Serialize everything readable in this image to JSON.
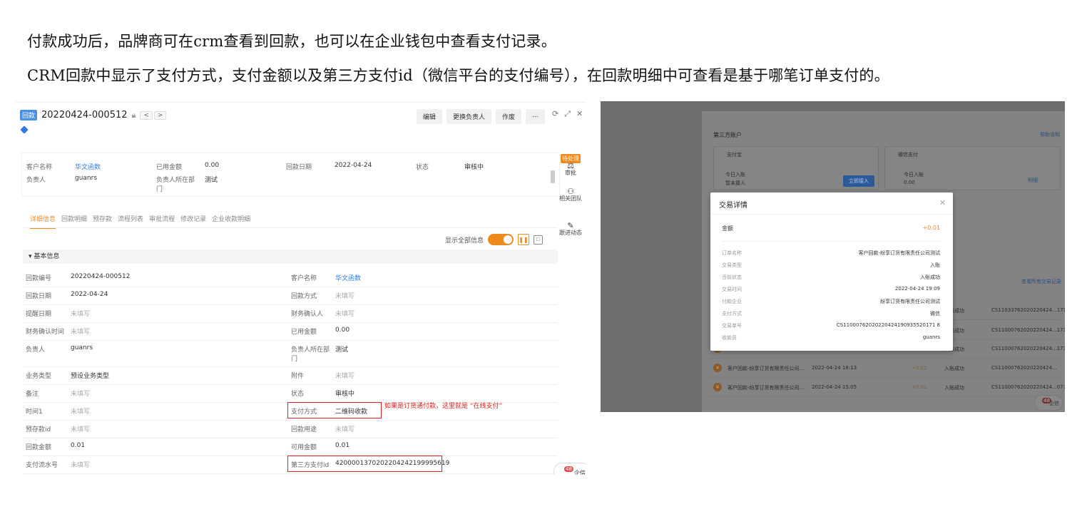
{
  "intro": {
    "line1": "付款成功后，品牌商可在crm查看到回款，也可以在企业钱包中查看支付记录。",
    "line2": "CRM回款中显示了支付方式，支付金额以及第三方支付id（微信平台的支付编号），在回款明细中可查看是基于哪笔订单支付的。"
  },
  "left": {
    "tag": "回款",
    "number": "20220424-000512",
    "actions": [
      "编辑",
      "更换负责人",
      "作废",
      "..."
    ],
    "summary": {
      "customer_label": "客户名称",
      "customer": "华文函数",
      "used_label": "已用金额",
      "used": "0.00",
      "date_label": "回款日期",
      "date": "2022-04-24",
      "status_label": "状态",
      "status": "审核中",
      "owner_label": "负责人",
      "owner": "guanrs",
      "dept_label": "负责人所在部门",
      "dept": "测试"
    },
    "tabs": [
      "详细信息",
      "回款明细",
      "预存款",
      "流程列表",
      "审批流程",
      "修改记录",
      "企业收款明细"
    ],
    "show_all": "显示全部信息",
    "section": "基本信息",
    "rows": [
      {
        "l1": "回款编号",
        "v1": "20220424-000512",
        "l2": "客户名称",
        "v2": "华文函数"
      },
      {
        "l1": "回款日期",
        "v1": "2022-04-24",
        "l2": "回款方式",
        "v2": "未填写"
      },
      {
        "l1": "提醒日期",
        "v1": "未填写",
        "l2": "财务确认人",
        "v2": "未填写"
      },
      {
        "l1": "财务确认时间",
        "v1": "未填写",
        "l2": "已用金额",
        "v2": "0.00"
      },
      {
        "l1": "负责人",
        "v1": "guanrs",
        "l2": "负责人所在部门",
        "v2": "测试"
      },
      {
        "l1": "业务类型",
        "v1": "预设业务类型",
        "l2": "附件",
        "v2": "未填写"
      },
      {
        "l1": "备注",
        "v1": "未填写",
        "l2": "状态",
        "v2": "审核中"
      },
      {
        "l1": "时间1",
        "v1": "未填写",
        "l2": "支付方式",
        "v2": "二维码收款"
      },
      {
        "l1": "预存款id",
        "v1": "未填写",
        "l2": "回款用途",
        "v2": "未填写"
      },
      {
        "l1": "回款金额",
        "v1": "0.01",
        "l2": "可用金额",
        "v2": "0.01"
      },
      {
        "l1": "支付流水号",
        "v1": "未填写",
        "l2": "第三方支付id",
        "v2": "4200001370202204242199995619"
      }
    ],
    "annotation": "如果是订货通付款，这里就是 “在线支付”",
    "side": {
      "pending": "待处理",
      "approve": "审批",
      "team": "相关团队",
      "follow": "跟进动态"
    },
    "chat_badge": "48",
    "chat_label": "企信"
  },
  "right": {
    "header": "第三方账户",
    "help": "帮助说明",
    "alipay": "支付宝",
    "wechat": "微信支付",
    "today_label": "今日入账",
    "alipay_status": "暂未接入",
    "connect_btn": "立即接入",
    "wechat_today": "0.00",
    "detail_link": "明细",
    "view_all": "查看所有交易记录",
    "list": [
      {
        "name": "",
        "date": "",
        "amount": "",
        "status": "入账成功",
        "no": "CS11033762020220424...1719"
      },
      {
        "name": "",
        "date": "",
        "amount": "",
        "status": "入账成功",
        "no": "CS11000762020220424...1718"
      },
      {
        "name": "",
        "date": "",
        "amount": "",
        "status": "入账成功",
        "no": "CS11000762020220424...1715"
      },
      {
        "name": "客户回款-纷享订货有限责任公司...",
        "date": "2022-04-24 18:13",
        "amount": "+0.01",
        "status": "入账成功",
        "no": "CS11000762020220424..."
      },
      {
        "name": "客户回款-纷享订货有限责任公司...",
        "date": "2022-04-24 15:05",
        "amount": "+0.01",
        "status": "入账成功",
        "no": "CS11000762020220424...0776"
      }
    ],
    "modal": {
      "title": "交易详情",
      "amount_label": "金额",
      "amount": "+0.01",
      "rows": [
        {
          "k": "订单名称",
          "v": "客户回款-纷享订货有限责任公司测试"
        },
        {
          "k": "交易类型",
          "v": "入账"
        },
        {
          "k": "当前状态",
          "v": "入账成功"
        },
        {
          "k": "交易时间",
          "v": "2022-04-24 19:09"
        },
        {
          "k": "付款企业",
          "v": "纷享订货有限责任公司测试"
        },
        {
          "k": "支付方式",
          "v": "微信"
        },
        {
          "k": "交易单号",
          "v": "CS11000762020220424190935520171 8"
        },
        {
          "k": "收款员",
          "v": "guanrs"
        }
      ]
    },
    "chat_badge": "48",
    "chat_label": "企信"
  }
}
